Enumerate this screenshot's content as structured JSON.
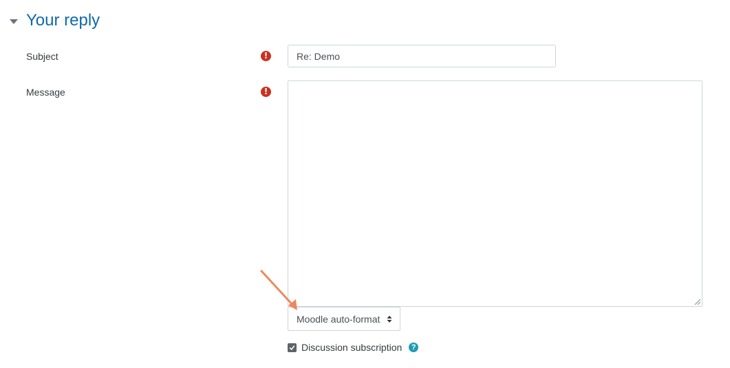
{
  "section": {
    "title": "Your reply"
  },
  "subject": {
    "label": "Subject",
    "value": "Re: Demo",
    "required_icon": "exclamation-circle-icon"
  },
  "message": {
    "label": "Message",
    "value": "",
    "required_icon": "exclamation-circle-icon"
  },
  "format_select": {
    "selected": "Moodle auto-format"
  },
  "subscription": {
    "label": "Discussion subscription",
    "checked": true,
    "help_icon": "question-circle-icon"
  },
  "colors": {
    "title": "#0e6aa8",
    "required": "#ca3120",
    "help": "#1f9bb5",
    "annotation_arrow": "#f0875e"
  }
}
